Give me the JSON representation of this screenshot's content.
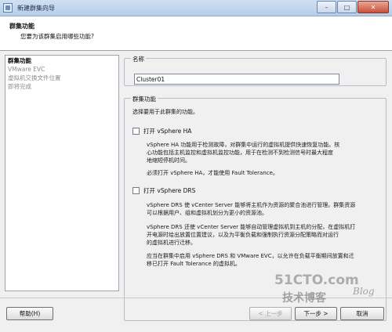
{
  "window": {
    "title": "新建群集向导",
    "min_label": "–",
    "max_label": "□",
    "close_label": "✕"
  },
  "header": {
    "title": "群集功能",
    "subtitle": "您要为该群集启用哪些功能?"
  },
  "nav": {
    "items": [
      {
        "label": "群集功能",
        "active": true
      },
      {
        "label": "VMware EVC",
        "active": false
      },
      {
        "label": "虚拟机交换文件位置",
        "active": false
      },
      {
        "label": "即将完成",
        "active": false
      }
    ]
  },
  "name_group": {
    "label": "名称",
    "value": "Cluster01"
  },
  "features": {
    "label": "群集功能",
    "instruction": "选择要用于此群集的功能。",
    "ha": {
      "checkbox_label": "打开 vSphere HA",
      "checked": false,
      "desc1_line1": "vSphere HA 功能用于检测故障，对群集中运行的虚拟机提供快速恢复功能。核",
      "desc1_line2": "心功能包括主机监控和虚拟机监控功能，用于在检测不到检测信号时最大程度",
      "desc1_line3": "地缩短停机时间。",
      "desc2": "必须打开 vSphere HA，才能使用 Fault Tolerance。"
    },
    "drs": {
      "checkbox_label": "打开 vSphere DRS",
      "checked": false,
      "desc1_line1": "vSphere DRS 使 vCenter Server 能够将主机作为资源的聚合池进行管理。群集资源",
      "desc1_line2": "可以根据用户、组和虚拟机划分为更小的资源池。",
      "desc2_line1": "vSphere DRS 还使 vCenter Server 能够自动管理虚拟机到主机的分配，在虚拟机打",
      "desc2_line2": "开电源时给出放置位置建议，以及为平衡负载和强制执行资源分配策略而对运行",
      "desc2_line3": "的虚拟机进行迁移。",
      "desc3_line1": "应当在群集中启用 vSphere DRS 和 VMware EVC，以允许在负载平衡期间放置和迁",
      "desc3_line2": "移已打开 Fault Tolerance 的虚拟机。"
    }
  },
  "buttons": {
    "help": "帮助(H)",
    "back": "< 上一步",
    "next": "下一步 >",
    "cancel": "取消"
  },
  "watermark": {
    "site": "51CTO.com",
    "sub": "技术博客",
    "blog": "Blog"
  }
}
